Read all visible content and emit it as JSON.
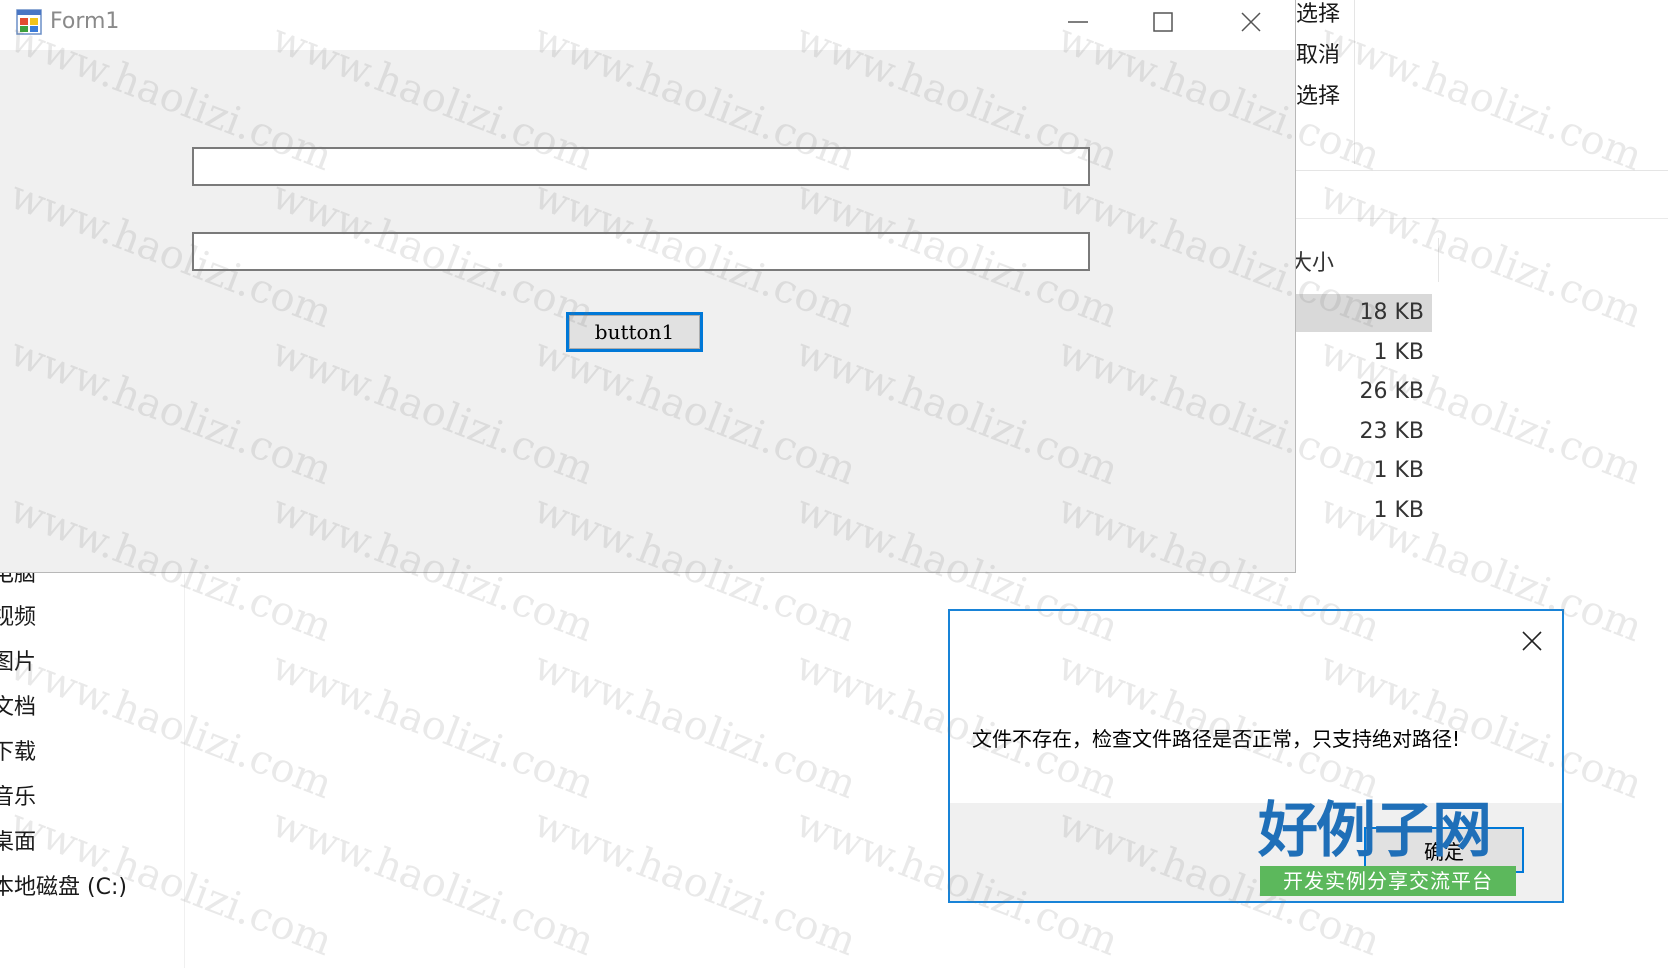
{
  "explorer": {
    "ribbon_items": [
      "选择",
      "取消",
      "选择"
    ],
    "size_column_header": "大小",
    "size_rows": [
      "18 KB",
      "1 KB",
      "26 KB",
      "23 KB",
      "1 KB",
      "1 KB"
    ],
    "nav_items": [
      "电脑",
      "视频",
      "图片",
      "文档",
      "下载",
      "音乐",
      "桌面",
      "本地磁盘 (C:)"
    ]
  },
  "form1": {
    "title": "Form1",
    "textbox1_value": "",
    "textbox2_value": "",
    "button_label": "button1"
  },
  "msgbox": {
    "message": "文件不存在，检查文件路径是否正常，只支持绝对路径!",
    "ok_label": "确定"
  },
  "watermark": {
    "text": "www.haolizi.com",
    "logo_main": "好例子网",
    "logo_sub": "开发实例分享交流平台"
  },
  "colors": {
    "accent": "#0078d7",
    "form_bg": "#f0f0f0",
    "logo_blue": "#1f6fb8",
    "logo_green": "#5cb85c"
  }
}
